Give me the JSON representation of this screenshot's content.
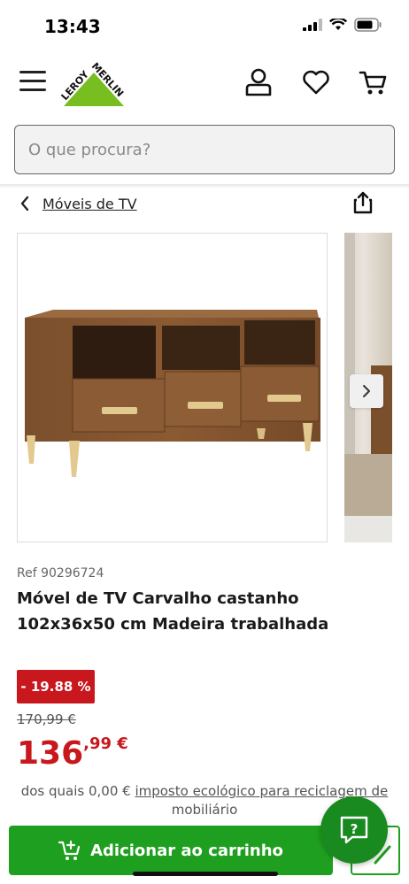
{
  "status_bar": {
    "time": "13:43"
  },
  "header": {
    "menu_icon": "hamburger-icon",
    "logo_text_left": "LEROY",
    "logo_text_right": "MERLIN",
    "icons": [
      "user-icon",
      "heart-icon",
      "cart-icon"
    ],
    "brand_color": "#78be20"
  },
  "search": {
    "placeholder": "O que procura?",
    "value": ""
  },
  "breadcrumb": {
    "label": "Móveis de TV"
  },
  "product": {
    "ref": "Ref 90296724",
    "title": "Móvel de TV Carvalho castanho 102x36x50 cm Madeira trabalhada",
    "discount": "- 19.88 %",
    "old_price": "170,99 €",
    "price_int": "136",
    "price_dec": ",99 €",
    "eco_prefix": "dos quais 0,00 € ",
    "eco_link": "imposto ecológico para reciclagem de",
    "eco_suffix": "mobiliário"
  },
  "actions": {
    "add_to_cart": "Adicionar ao carrinho",
    "primary_color": "#1f9f1f",
    "price_color": "#c8171d"
  }
}
